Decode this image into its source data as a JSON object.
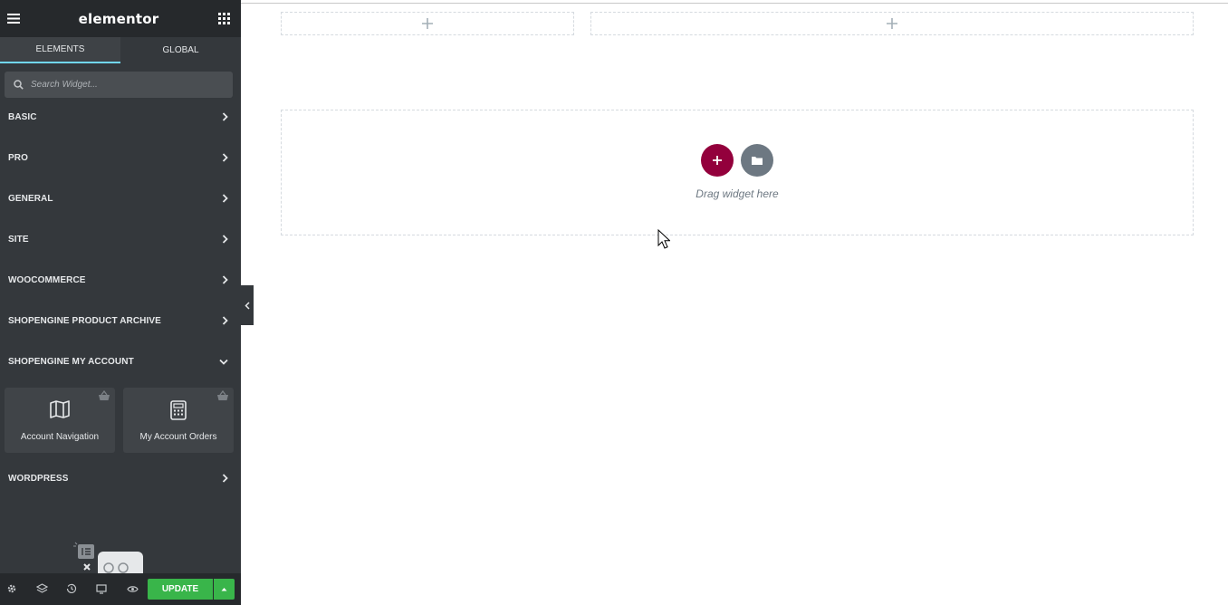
{
  "app": {
    "logo": "elementor"
  },
  "tabs": [
    {
      "label": "ELEMENTS",
      "active": true
    },
    {
      "label": "GLOBAL",
      "active": false
    }
  ],
  "search": {
    "placeholder": "Search Widget..."
  },
  "categories": [
    {
      "label": "BASIC",
      "expanded": false
    },
    {
      "label": "PRO",
      "expanded": false
    },
    {
      "label": "GENERAL",
      "expanded": false
    },
    {
      "label": "SITE",
      "expanded": false
    },
    {
      "label": "WOOCOMMERCE",
      "expanded": false
    },
    {
      "label": "SHOPENGINE PRODUCT ARCHIVE",
      "expanded": false
    },
    {
      "label": "SHOPENGINE MY ACCOUNT",
      "expanded": true
    },
    {
      "label": "WORDPRESS",
      "expanded": false
    }
  ],
  "widgets": [
    {
      "label": "Account Navigation",
      "icon": "map-icon"
    },
    {
      "label": "My Account Orders",
      "icon": "calculator-icon"
    }
  ],
  "footer": {
    "update_label": "UPDATE",
    "tools": [
      "settings-icon",
      "layers-icon",
      "history-icon",
      "responsive-icon",
      "preview-icon"
    ]
  },
  "canvas": {
    "drag_text": "Drag widget here"
  },
  "colors": {
    "sidebar_bg": "#34383c",
    "topbar_bg": "#26292c",
    "tab_active_underline": "#71d7f7",
    "add_button": "#93003c",
    "template_button": "#6d7882",
    "update_button": "#39b54a"
  }
}
